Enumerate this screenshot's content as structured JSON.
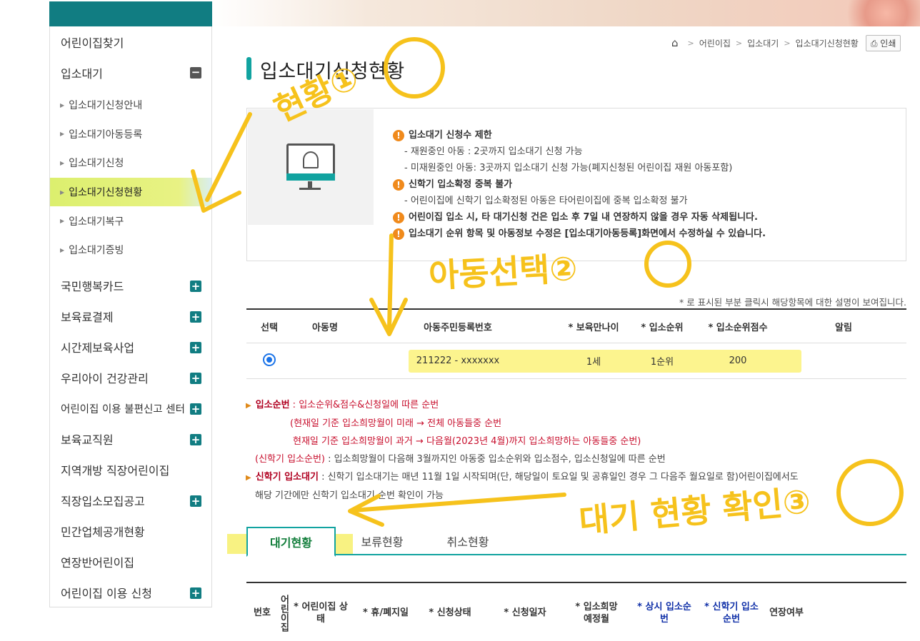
{
  "sidebar": {
    "top_items": [
      {
        "label": "어린이집찾기"
      },
      {
        "label": "입소대기"
      }
    ],
    "sub_items": [
      {
        "label": "입소대기신청안내"
      },
      {
        "label": "입소대기아동등록"
      },
      {
        "label": "입소대기신청"
      },
      {
        "label": "입소대기신청현황"
      },
      {
        "label": "입소대기복구"
      },
      {
        "label": "입소대기증빙"
      }
    ],
    "bottom_items": [
      {
        "label": "국민행복카드"
      },
      {
        "label": "보육료결제"
      },
      {
        "label": "시간제보육사업"
      },
      {
        "label": "우리아이 건강관리"
      },
      {
        "label": "어린이집 이용 불편신고 센터"
      },
      {
        "label": "보육교직원"
      },
      {
        "label": "지역개방 직장어린이집"
      },
      {
        "label": "직장입소모집공고"
      },
      {
        "label": "민간업체공개현황"
      },
      {
        "label": "연장반어린이집"
      },
      {
        "label": "어린이집 이용 신청"
      }
    ]
  },
  "breadcrumb": {
    "items": [
      "어린이집",
      "입소대기",
      "입소대기신청현황"
    ],
    "print_label": "인쇄"
  },
  "page_title": "입소대기신청현황",
  "info": {
    "notes": [
      {
        "head": "입소대기 신청수 제한",
        "subs": [
          "- 재원중인 아동 : 2곳까지 입소대기 신청 가능",
          "- 미재원중인 아동: 3곳까지 입소대기 신청 가능(폐지신청된 어린이집 재원 아동포함)"
        ]
      },
      {
        "head": "신학기 입소확정 중복 불가",
        "subs": [
          "- 어린이집에 신학기 입소확정된 아동은 타어린이집에 중복 입소확정 불가"
        ]
      },
      {
        "head": "어린이집 입소 시, 타 대기신청 건은 입소 후 7일 내 연장하지 않을 경우 자동 삭제됩니다.",
        "subs": []
      },
      {
        "head": "입소대기 순위 항목 및 아동정보 수정은 [입소대기아동등록]화면에서 수정하실 수 있습니다.",
        "subs": []
      }
    ]
  },
  "help_text": "* 로 표시된 부분 클릭시 해당항목에 대한 설명이 보여집니다.",
  "child_table": {
    "headers": [
      "선택",
      "아동명",
      "아동주민등록번호",
      "* 보육만나이",
      "* 입소순위",
      "* 입소순위점수",
      "알림"
    ],
    "row": {
      "name": "",
      "id_number": "211222 - xxxxxxx",
      "age": "1세",
      "rank": "1순위",
      "score": "200",
      "alert": ""
    }
  },
  "explain": {
    "l1_label": "입소순번",
    "l1_text": " : 입소순위&점수&신청일에 따른 순번",
    "l2_text": "(현재일 기준 입소희망월이 미래 → 전체 아동들중 순번",
    "l3_text": "현재일 기준 입소희망월이 과거 → 다음월(2023년 4월)까지 입소희망하는 아동들중 순번)",
    "l4_label": "(신학기 입소순번)",
    "l4_text": " : 입소희망월이 다음해 3월까지인 아동중 입소순위와 입소점수, 입소신청일에 따른 순번",
    "l5_label": "신학기 입소대기",
    "l5_text": " : 신학기 입소대기는 매년 11월 1일 시작되며(단, 해당일이 토요일 및 공휴일인 경우 그 다음주 월요일로 함)어린이집에서도",
    "l6_text": "해당 기간에만 신학기 입소대기 순번 확인이 가능"
  },
  "tabs": [
    {
      "label": "대기현황"
    },
    {
      "label": "보류현황"
    },
    {
      "label": "취소현황"
    }
  ],
  "result_table": {
    "headers": [
      "번호",
      "어린이집",
      "* 어린이집 상태",
      "* 휴/폐지일",
      "* 신청상태",
      "* 신청일자",
      "* 입소희망 예정월",
      "* 상시 입소순번",
      "* 신학기 입소순번",
      "연장여부"
    ]
  },
  "annotations": {
    "a1": "현황①",
    "a2": "아동선택②",
    "a3": "대기 현황 확인③"
  },
  "colors": {
    "brand_teal": "#117d82",
    "accent_teal": "#11a3a0",
    "warning_orange": "#f08a1c",
    "annotation_yellow": "#f6c21c",
    "highlight_yellow": "#fbf27a"
  }
}
